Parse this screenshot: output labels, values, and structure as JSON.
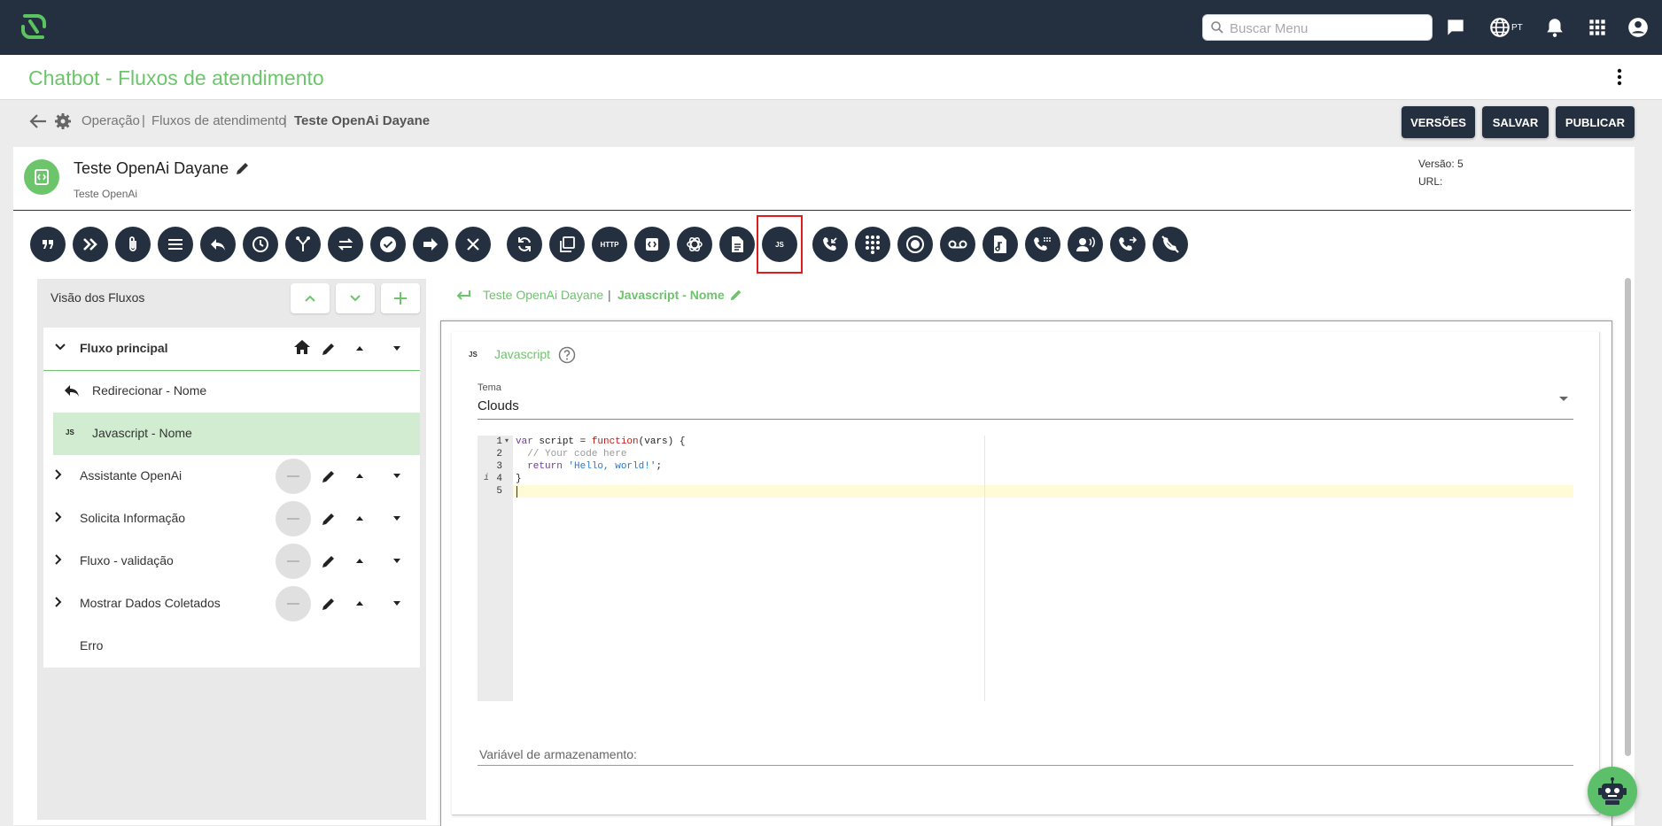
{
  "topbar": {
    "search_placeholder": "Buscar Menu",
    "language": "PT"
  },
  "page": {
    "title": "Chatbot - Fluxos de atendimento"
  },
  "breadcrumb": {
    "items": [
      "Operação",
      "Fluxos de atendimento"
    ],
    "separator": "|",
    "current": "Teste OpenAi Dayane"
  },
  "actions": {
    "versions": "VERSÕES",
    "save": "SALVAR",
    "publish": "PUBLICAR"
  },
  "flow": {
    "name": "Teste OpenAi Dayane",
    "subtitle": "Teste OpenAi",
    "version": "Versão: 5",
    "url": "URL:"
  },
  "toolbar": {
    "http_label": "HTTP",
    "js_label": "JS",
    "icons": [
      "quote-icon",
      "double-chevron-icon",
      "attachment-icon",
      "menu-list-icon",
      "reply-icon",
      "clock-icon",
      "fork-icon",
      "swap-icon",
      "check-circle-icon",
      "arrow-right-icon",
      "close-icon",
      "refresh-icon",
      "copy-icon",
      "http-icon",
      "code-icon",
      "openai-icon",
      "document-icon",
      "javascript-icon",
      "incoming-call-icon",
      "dialpad-icon",
      "record-icon",
      "voicemail-icon",
      "audio-file-icon",
      "phone-keypad-icon",
      "voice-agent-icon",
      "call-transfer-icon",
      "call-end-icon"
    ],
    "highlighted": "javascript-icon"
  },
  "sidebar": {
    "title": "Visão dos Fluxos",
    "main_flow": "Fluxo principal",
    "items": [
      {
        "label": "Redirecionar - Nome",
        "icon": "reply-icon"
      },
      {
        "label": "Javascript - Nome",
        "icon": "JS",
        "selected": true
      },
      {
        "label": "Assistante OpenAi"
      },
      {
        "label": "Solicita Informação"
      },
      {
        "label": "Fluxo - validação"
      },
      {
        "label": "Mostrar Dados Coletados"
      },
      {
        "label": "Erro"
      }
    ]
  },
  "editor": {
    "crumb_flow": "Teste OpenAi Dayane",
    "crumb_sep": "|",
    "crumb_node": "Javascript - Nome",
    "block_tag": "JS",
    "block_title": "Javascript",
    "theme_label": "Tema",
    "theme_value": "Clouds",
    "line_numbers": [
      "1",
      "2",
      "3",
      "4",
      "5"
    ],
    "code": {
      "l1a": "var",
      "l1b": " script = ",
      "l1c": "function",
      "l1d": "(vars) {",
      "l2": "  // Your code here",
      "l3a": "  return ",
      "l3b": "'Hello, world!'",
      "l3c": ";",
      "l4": "}"
    },
    "storage_placeholder": "Variável de armazenamento:"
  },
  "colors": {
    "dark": "#243040",
    "accent": "#6cc56b",
    "highlight": "#e01d1d"
  }
}
